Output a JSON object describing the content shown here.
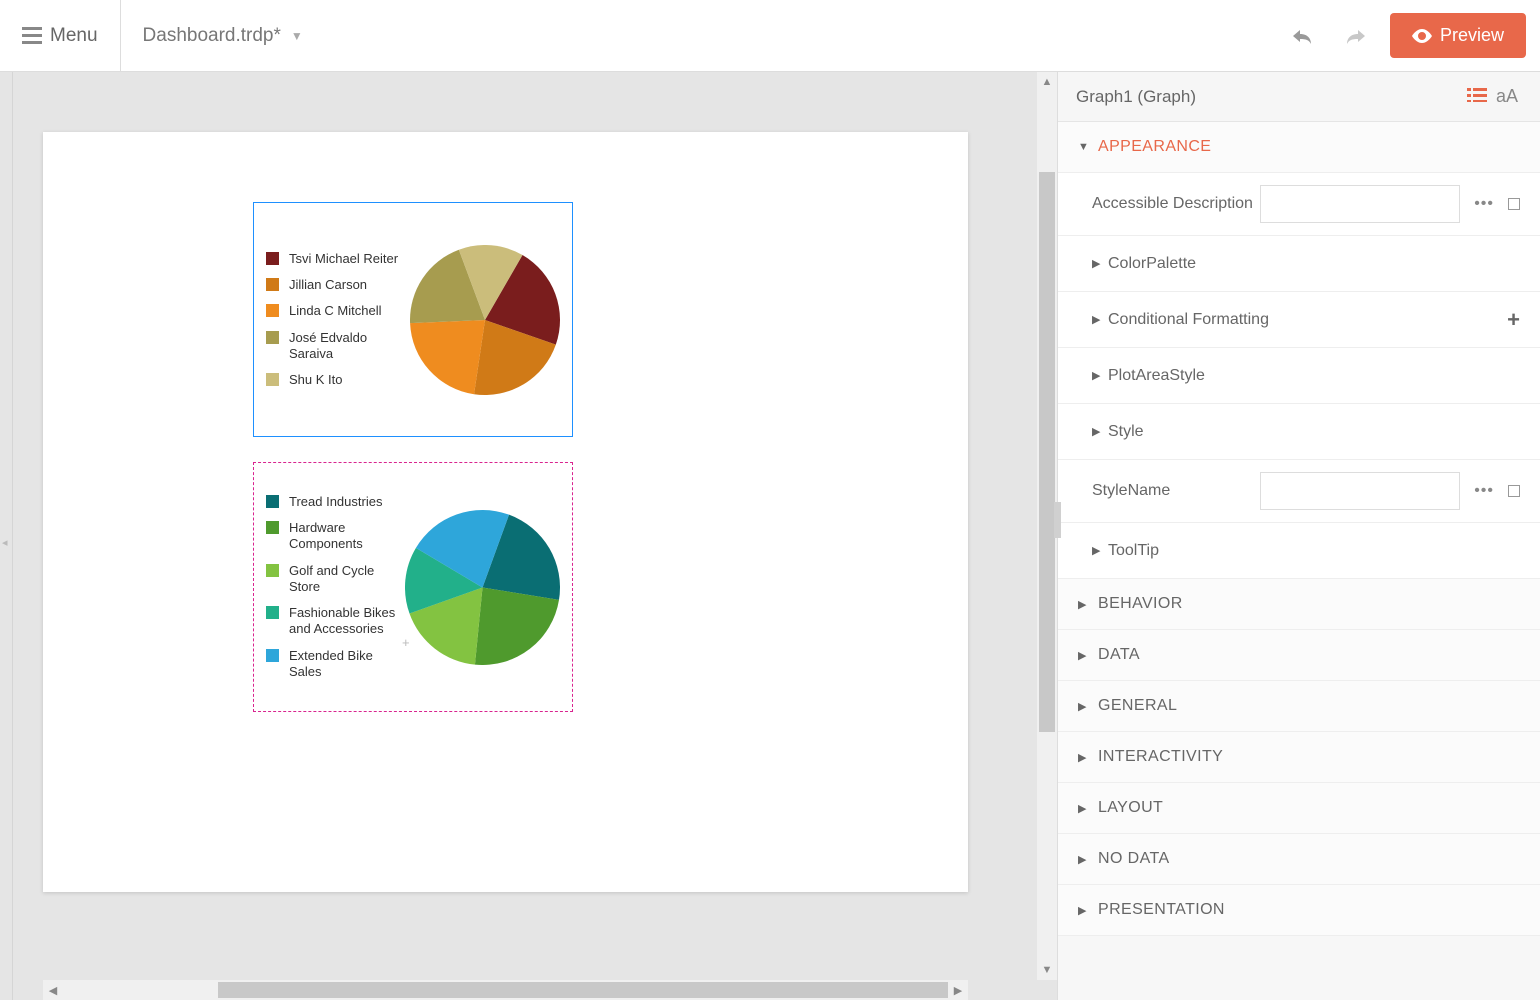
{
  "toolbar": {
    "menu_label": "Menu",
    "file_name": "Dashboard.trdp*",
    "preview_label": "Preview"
  },
  "props": {
    "title": "Graph1 (Graph)",
    "groups": {
      "appearance": "APPEARANCE",
      "behavior": "BEHAVIOR",
      "data": "DATA",
      "general": "GENERAL",
      "interactivity": "INTERACTIVITY",
      "layout": "LAYOUT",
      "nodata": "NO DATA",
      "presentation": "PRESENTATION"
    },
    "appearance_items": {
      "accessible_description": "Accessible Description",
      "color_palette": "ColorPalette",
      "conditional_formatting": "Conditional Formatting",
      "plot_area_style": "PlotAreaStyle",
      "style": "Style",
      "style_name": "StyleName",
      "tooltip": "ToolTip"
    }
  },
  "colors": {
    "accent": "#e8684a",
    "selection": "#1e90ff",
    "dashed": "#d9248f"
  },
  "chart_data": [
    {
      "type": "pie",
      "title": "",
      "series": [
        {
          "name": "Tsvi Michael Reiter",
          "value": 22,
          "color": "#7a1d1d"
        },
        {
          "name": "Jillian  Carson",
          "value": 22,
          "color": "#d07a17"
        },
        {
          "name": "Linda C Mitchell",
          "value": 22,
          "color": "#ef8c1f"
        },
        {
          "name": "José Edvaldo Saraiva",
          "value": 20,
          "color": "#a79c4f"
        },
        {
          "name": "Shu K Ito",
          "value": 14,
          "color": "#cbbd7b"
        }
      ]
    },
    {
      "type": "pie",
      "title": "",
      "series": [
        {
          "name": "Tread Industries",
          "value": 22,
          "color": "#0a6e73"
        },
        {
          "name": "Hardware Components",
          "value": 24,
          "color": "#4f9a2d"
        },
        {
          "name": "Golf and Cycle Store",
          "value": 18,
          "color": "#83c341"
        },
        {
          "name": "Fashionable Bikes and Accessories",
          "value": 14,
          "color": "#22b08a"
        },
        {
          "name": "Extended Bike Sales",
          "value": 22,
          "color": "#2ea6da"
        }
      ]
    }
  ]
}
